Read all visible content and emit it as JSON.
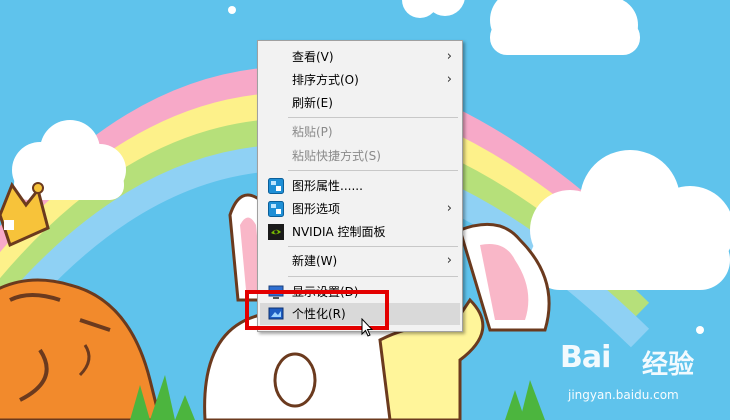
{
  "desktop": {
    "wallpaper": "cartoon-rainbow-wallpaper"
  },
  "context_menu": {
    "items": [
      {
        "label": "查看(V)",
        "has_submenu": true
      },
      {
        "label": "排序方式(O)",
        "has_submenu": true
      },
      {
        "label": "刷新(E)"
      },
      {
        "label": "粘贴(P)",
        "disabled": true
      },
      {
        "label": "粘贴快捷方式(S)",
        "disabled": true
      },
      {
        "label": "图形属性......",
        "icon": "intel-graphics-icon"
      },
      {
        "label": "图形选项",
        "icon": "intel-graphics-icon",
        "has_submenu": true
      },
      {
        "label": "NVIDIA 控制面板",
        "icon": "nvidia-icon"
      },
      {
        "label": "新建(W)",
        "has_submenu": true
      },
      {
        "label": "显示设置(D)",
        "icon": "display-icon"
      },
      {
        "label": "个性化(R)",
        "icon": "personalize-icon",
        "highlighted": true
      }
    ],
    "submenu_arrow": "›"
  },
  "annotation": {
    "color": "#e30000",
    "target": "个性化(R)"
  },
  "watermark": {
    "brand": "Bai",
    "cn": "经验",
    "site": "jingyan.baidu.com"
  },
  "colors": {
    "menu_bg": "#f2f2f2",
    "hover_bg": "#d9d9d9",
    "disabled_text": "#8a8a8a",
    "sky": "#5fc3ec"
  }
}
